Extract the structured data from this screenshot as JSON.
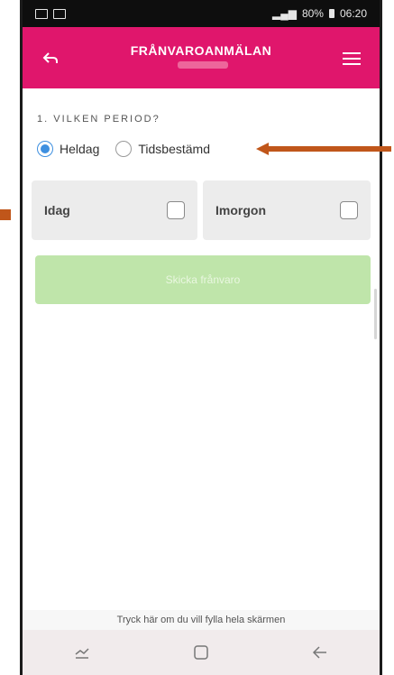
{
  "status": {
    "right_text": "80%",
    "time": "06:20"
  },
  "header": {
    "title": "FRÅNVAROANMÄLAN"
  },
  "form": {
    "section_label": "1. VILKEN PERIOD?",
    "radio_options": [
      {
        "label": "Heldag",
        "checked": true
      },
      {
        "label": "Tidsbestämd",
        "checked": false
      }
    ],
    "days": [
      {
        "label": "Idag",
        "checked": false
      },
      {
        "label": "Imorgon",
        "checked": false
      }
    ],
    "submit_label": "Skicka frånvaro"
  },
  "footer": {
    "hint": "Tryck här om du vill fylla hela skärmen"
  },
  "colors": {
    "accent": "#e0166c",
    "radio": "#3d8fe0",
    "submit": "#bfe5aa",
    "arrow": "#c0561a"
  },
  "icons": {
    "back": "back-arrow-icon",
    "menu": "hamburger-menu-icon",
    "nav_recent": "recent-apps-icon",
    "nav_home": "home-icon",
    "nav_back": "back-icon"
  }
}
